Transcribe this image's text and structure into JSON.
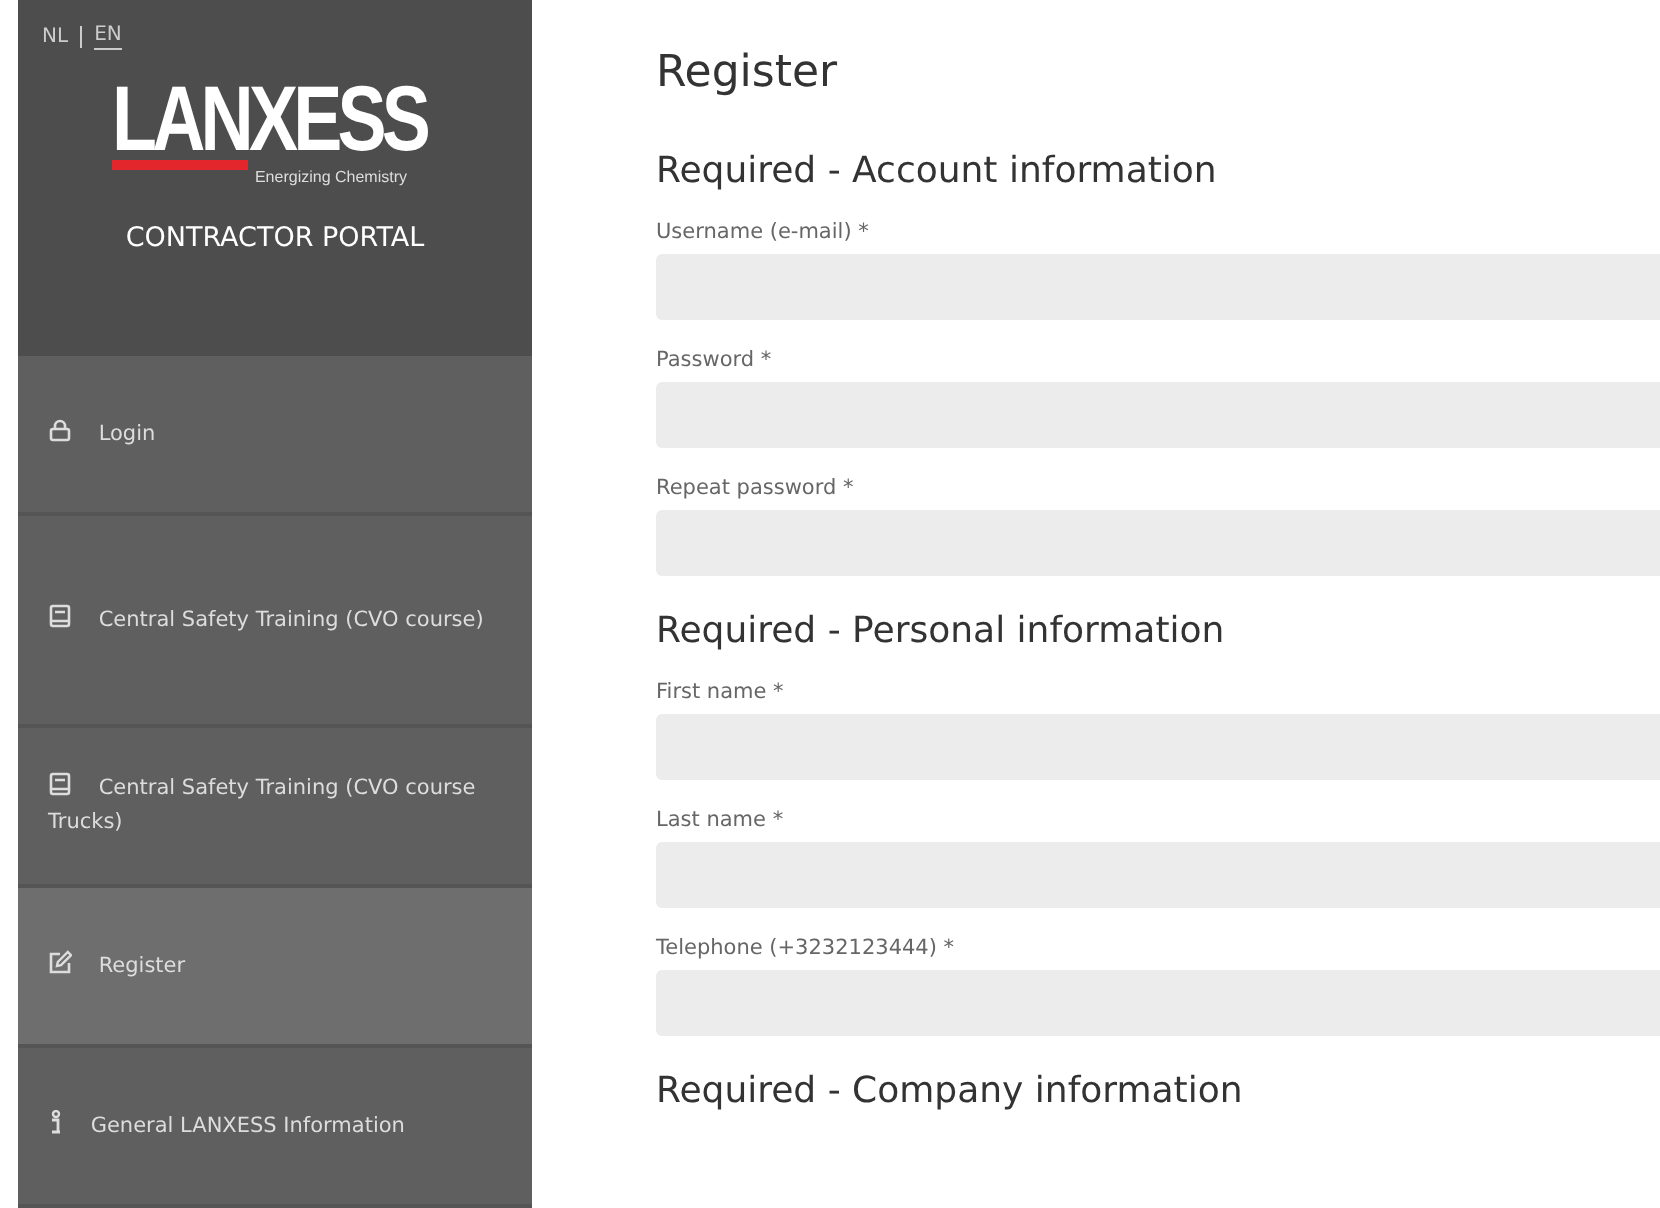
{
  "languages": [
    {
      "label": "NL",
      "selected": false
    },
    {
      "label": "EN",
      "selected": true
    }
  ],
  "logo": {
    "wordmark_left": "LAN",
    "wordmark_right": "XESS",
    "tagline": "Energizing Chemistry"
  },
  "portal_title": "CONTRACTOR PORTAL",
  "sidebar": {
    "items": [
      {
        "label": "Login",
        "kind": "login",
        "selected": false
      },
      {
        "label": "Central Safety Training (CVO course)",
        "kind": "course",
        "selected": false
      },
      {
        "label": "Central Safety Training (CVO course Trucks)",
        "kind": "course",
        "selected": false
      },
      {
        "label": "Register",
        "kind": "register",
        "selected": true
      },
      {
        "label": "General LANXESS Information",
        "kind": "information",
        "selected": false
      }
    ]
  },
  "page_title": "Register",
  "sections": [
    {
      "heading": "Required - Account information",
      "fields": [
        {
          "label": "Username (e-mail) *"
        },
        {
          "label": "Password *"
        },
        {
          "label": "Repeat password *"
        }
      ]
    },
    {
      "heading": "Required - Personal information",
      "fields": [
        {
          "label": "First name *"
        },
        {
          "label": "Last name *"
        },
        {
          "label": "Telephone (+3232123444) *"
        }
      ]
    },
    {
      "heading": "Required - Company information"
    }
  ]
}
